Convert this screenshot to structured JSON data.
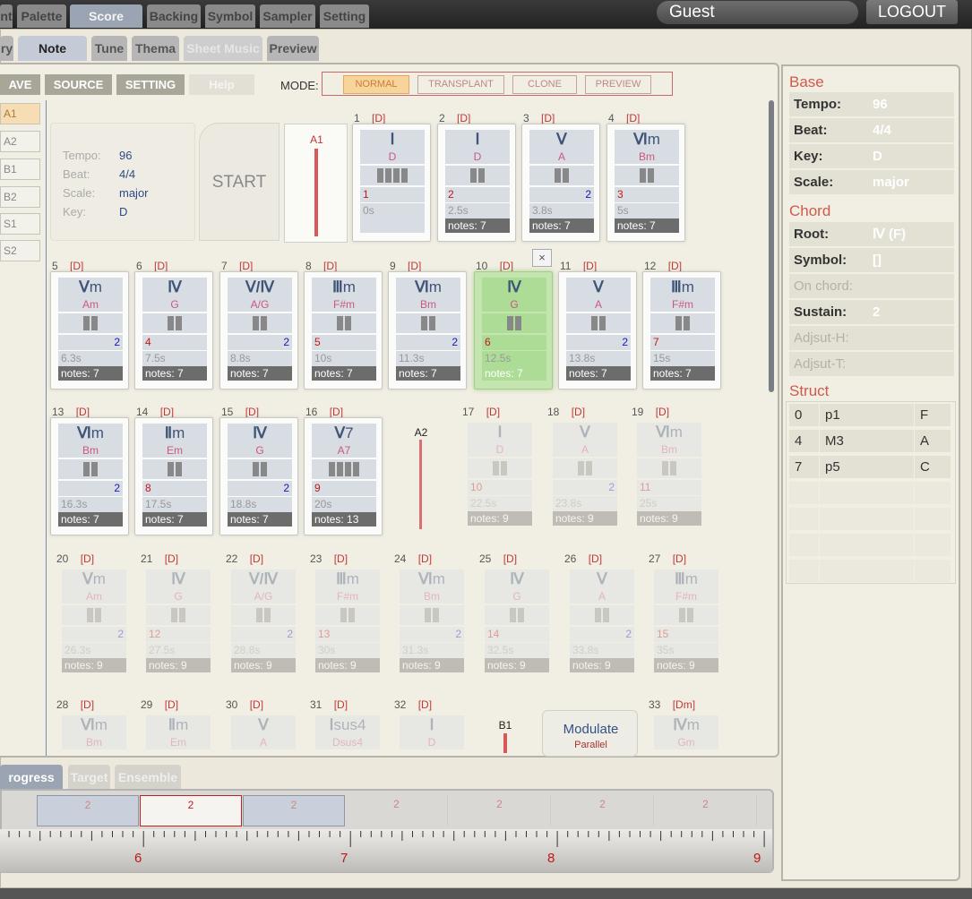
{
  "topbar": {
    "tabs": [
      "nt",
      "Palette",
      "Score",
      "Backing",
      "Symbol",
      "Sampler",
      "Setting"
    ],
    "user": "Guest",
    "logout": "LOGOUT"
  },
  "subtabs": [
    "ry",
    "Note",
    "Tune",
    "Thema",
    "Sheet Music",
    "Preview"
  ],
  "toolbar": {
    "save": "AVE",
    "source": "SOURCE",
    "setting": "SETTING",
    "help": "Help",
    "mode_label": "MODE:",
    "modes": [
      "NORMAL",
      "TRANSPLANT",
      "CLONE",
      "PREVIEW"
    ]
  },
  "sections": [
    "A1",
    "A2",
    "B1",
    "B2",
    "S1",
    "S2"
  ],
  "info": {
    "tempo_label": "Tempo:",
    "tempo": "96",
    "beat_label": "Beat:",
    "beat": "4/4",
    "scale_label": "Scale:",
    "scale": "major",
    "key_label": "Key:",
    "key": "D"
  },
  "start": "START",
  "markers": {
    "a1": "A1",
    "a2": "A2",
    "b1": "B1"
  },
  "cards": [
    {
      "n": "1",
      "k": "[D]",
      "rom": "Ⅰ",
      "sfx": "",
      "name": "D",
      "beats": 4,
      "l": "1",
      "r": "",
      "t": "0s",
      "notes": ""
    },
    {
      "n": "2",
      "k": "[D]",
      "rom": "Ⅰ",
      "sfx": "",
      "name": "D",
      "beats": 2,
      "l": "2",
      "r": "",
      "t": "2.5s",
      "notes": "notes: 7"
    },
    {
      "n": "3",
      "k": "[D]",
      "rom": "Ⅴ",
      "sfx": "",
      "name": "A",
      "beats": 2,
      "l": "",
      "r": "2",
      "t": "3.8s",
      "notes": "notes: 7"
    },
    {
      "n": "4",
      "k": "[D]",
      "rom": "Ⅵ",
      "sfx": "m",
      "name": "Bm",
      "beats": 2,
      "l": "3",
      "r": "",
      "t": "5s",
      "notes": "notes: 7"
    },
    {
      "n": "5",
      "k": "[D]",
      "rom": "Ⅴ",
      "sfx": "m",
      "name": "Am",
      "beats": 2,
      "l": "",
      "r": "2",
      "t": "6.3s",
      "notes": "notes: 7"
    },
    {
      "n": "6",
      "k": "[D]",
      "rom": "Ⅳ",
      "sfx": "",
      "name": "G",
      "beats": 2,
      "l": "4",
      "r": "",
      "t": "7.5s",
      "notes": "notes: 7"
    },
    {
      "n": "7",
      "k": "[D]",
      "rom": "Ⅴ/Ⅳ",
      "sfx": "",
      "name": "A/G",
      "beats": 2,
      "l": "",
      "r": "2",
      "t": "8.8s",
      "notes": "notes: 7"
    },
    {
      "n": "8",
      "k": "[D]",
      "rom": "Ⅲ",
      "sfx": "m",
      "name": "F#m",
      "beats": 2,
      "l": "5",
      "r": "",
      "t": "10s",
      "notes": "notes: 7"
    },
    {
      "n": "9",
      "k": "[D]",
      "rom": "Ⅵ",
      "sfx": "m",
      "name": "Bm",
      "beats": 2,
      "l": "",
      "r": "2",
      "t": "11.3s",
      "notes": "notes: 7"
    },
    {
      "n": "10",
      "k": "[D]",
      "rom": "Ⅳ",
      "sfx": "",
      "name": "G",
      "beats": 2,
      "l": "6",
      "r": "",
      "t": "12.5s",
      "notes": "notes: 7"
    },
    {
      "n": "11",
      "k": "[D]",
      "rom": "Ⅴ",
      "sfx": "",
      "name": "A",
      "beats": 2,
      "l": "",
      "r": "2",
      "t": "13.8s",
      "notes": "notes: 7"
    },
    {
      "n": "12",
      "k": "[D]",
      "rom": "Ⅲ",
      "sfx": "m",
      "name": "F#m",
      "beats": 2,
      "l": "7",
      "r": "",
      "t": "15s",
      "notes": "notes: 7"
    },
    {
      "n": "13",
      "k": "[D]",
      "rom": "Ⅵ",
      "sfx": "m",
      "name": "Bm",
      "beats": 2,
      "l": "",
      "r": "2",
      "t": "16.3s",
      "notes": "notes: 7"
    },
    {
      "n": "14",
      "k": "[D]",
      "rom": "Ⅱ",
      "sfx": "m",
      "name": "Em",
      "beats": 2,
      "l": "8",
      "r": "",
      "t": "17.5s",
      "notes": "notes: 7"
    },
    {
      "n": "15",
      "k": "[D]",
      "rom": "Ⅳ",
      "sfx": "",
      "name": "G",
      "beats": 2,
      "l": "",
      "r": "2",
      "t": "18.8s",
      "notes": "notes: 7"
    },
    {
      "n": "16",
      "k": "[D]",
      "rom": "Ⅴ",
      "sfx": "7",
      "name": "A7",
      "beats": 4,
      "l": "9",
      "r": "",
      "t": "20s",
      "notes": "notes: 13"
    },
    {
      "n": "17",
      "k": "[D]",
      "rom": "Ⅰ",
      "sfx": "",
      "name": "D",
      "beats": 2,
      "l": "10",
      "r": "",
      "t": "22.5s",
      "notes": "notes: 9"
    },
    {
      "n": "18",
      "k": "[D]",
      "rom": "Ⅴ",
      "sfx": "",
      "name": "A",
      "beats": 2,
      "l": "",
      "r": "2",
      "t": "23.8s",
      "notes": "notes: 9"
    },
    {
      "n": "19",
      "k": "[D]",
      "rom": "Ⅵ",
      "sfx": "m",
      "name": "Bm",
      "beats": 2,
      "l": "11",
      "r": "",
      "t": "25s",
      "notes": "notes: 9"
    },
    {
      "n": "20",
      "k": "[D]",
      "rom": "Ⅴ",
      "sfx": "m",
      "name": "Am",
      "beats": 2,
      "l": "",
      "r": "2",
      "t": "26.3s",
      "notes": "notes: 9"
    },
    {
      "n": "21",
      "k": "[D]",
      "rom": "Ⅳ",
      "sfx": "",
      "name": "G",
      "beats": 2,
      "l": "12",
      "r": "",
      "t": "27.5s",
      "notes": "notes: 9"
    },
    {
      "n": "22",
      "k": "[D]",
      "rom": "Ⅴ/Ⅳ",
      "sfx": "",
      "name": "A/G",
      "beats": 2,
      "l": "",
      "r": "2",
      "t": "28.8s",
      "notes": "notes: 9"
    },
    {
      "n": "23",
      "k": "[D]",
      "rom": "Ⅲ",
      "sfx": "m",
      "name": "F#m",
      "beats": 2,
      "l": "13",
      "r": "",
      "t": "30s",
      "notes": "notes: 9"
    },
    {
      "n": "24",
      "k": "[D]",
      "rom": "Ⅵ",
      "sfx": "m",
      "name": "Bm",
      "beats": 2,
      "l": "",
      "r": "2",
      "t": "31.3s",
      "notes": "notes: 9"
    },
    {
      "n": "25",
      "k": "[D]",
      "rom": "Ⅳ",
      "sfx": "",
      "name": "G",
      "beats": 2,
      "l": "14",
      "r": "",
      "t": "32.5s",
      "notes": "notes: 9"
    },
    {
      "n": "26",
      "k": "[D]",
      "rom": "Ⅴ",
      "sfx": "",
      "name": "A",
      "beats": 2,
      "l": "",
      "r": "2",
      "t": "33.8s",
      "notes": "notes: 9"
    },
    {
      "n": "27",
      "k": "[D]",
      "rom": "Ⅲ",
      "sfx": "m",
      "name": "F#m",
      "beats": 2,
      "l": "15",
      "r": "",
      "t": "35s",
      "notes": "notes: 9"
    },
    {
      "n": "28",
      "k": "[D]",
      "rom": "Ⅵ",
      "sfx": "m",
      "name": "Bm",
      "beats": 0,
      "l": "",
      "r": "",
      "t": "",
      "notes": ""
    },
    {
      "n": "29",
      "k": "[D]",
      "rom": "Ⅱ",
      "sfx": "m",
      "name": "Em",
      "beats": 0,
      "l": "",
      "r": "",
      "t": "",
      "notes": ""
    },
    {
      "n": "30",
      "k": "[D]",
      "rom": "Ⅴ",
      "sfx": "",
      "name": "A",
      "beats": 0,
      "l": "",
      "r": "",
      "t": "",
      "notes": ""
    },
    {
      "n": "31",
      "k": "[D]",
      "rom": "Ⅰ",
      "sfx": "sus4",
      "name": "Dsus4",
      "beats": 0,
      "l": "",
      "r": "",
      "t": "",
      "notes": ""
    },
    {
      "n": "32",
      "k": "[D]",
      "rom": "Ⅰ",
      "sfx": "",
      "name": "D",
      "beats": 0,
      "l": "",
      "r": "",
      "t": "",
      "notes": ""
    },
    {
      "n": "33",
      "k": "[Dm]",
      "rom": "Ⅳ",
      "sfx": "m",
      "name": "Gm",
      "beats": 0,
      "l": "",
      "r": "",
      "t": "",
      "notes": ""
    }
  ],
  "close": "×",
  "modulate": {
    "title": "Modulate",
    "sub": "Parallel"
  },
  "base": {
    "title": "Base",
    "rows": [
      {
        "label": "Tempo:",
        "value": "96"
      },
      {
        "label": "Beat:",
        "value": "4/4"
      },
      {
        "label": "Key:",
        "value": "D"
      },
      {
        "label": "Scale:",
        "value": "major"
      }
    ]
  },
  "chord": {
    "title": "Chord",
    "rows": [
      {
        "label": "Root:",
        "value": "Ⅳ (F)"
      },
      {
        "label": "Symbol:",
        "value": "[]"
      },
      {
        "label": "On chord:",
        "value": ""
      },
      {
        "label": "Sustain:",
        "value": "2"
      },
      {
        "label": "Adjsut-H:",
        "value": ""
      },
      {
        "label": "Adjsut-T:",
        "value": ""
      }
    ]
  },
  "struct": {
    "title": "Struct",
    "rows": [
      [
        "0",
        "p1",
        "F"
      ],
      [
        "4",
        "M3",
        "A"
      ],
      [
        "7",
        "p5",
        "C"
      ]
    ]
  },
  "bottomtabs": [
    "rogress",
    "Target",
    "Ensemble"
  ],
  "timeline": {
    "segments": [
      "2",
      "2",
      "2",
      "2",
      "2",
      "2",
      "2"
    ],
    "ticks": [
      "6",
      "7",
      "8",
      "9"
    ]
  }
}
